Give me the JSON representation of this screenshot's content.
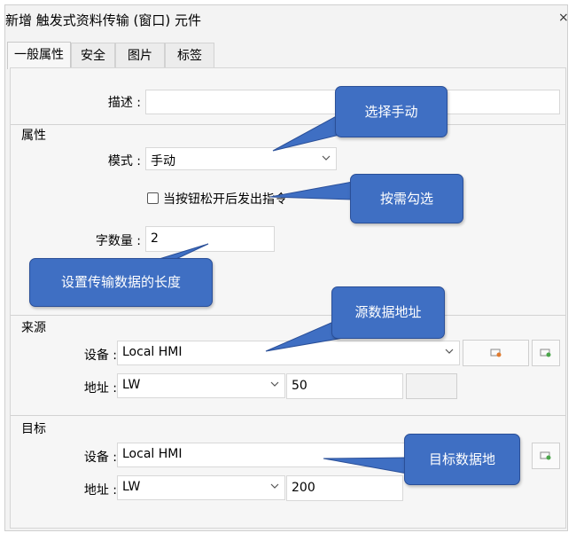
{
  "window": {
    "title": "新增 触发式资料传输 (窗口) 元件",
    "close_glyph": "×"
  },
  "tabs": [
    {
      "label": "一般属性",
      "active": true
    },
    {
      "label": "安全",
      "active": false
    },
    {
      "label": "图片",
      "active": false
    },
    {
      "label": "标签",
      "active": false
    }
  ],
  "form": {
    "description_label": "描述 :",
    "description_value": "",
    "attributes_section": "属性",
    "mode_label": "模式 :",
    "mode_value": "手动",
    "checkbox_label": "当按钮松开后发出指令",
    "checkbox_checked": false,
    "word_count_label": "字数量 :",
    "word_count_value": "2"
  },
  "source": {
    "section": "来源",
    "device_label": "设备 :",
    "device_value": "Local HMI",
    "address_label": "地址 :",
    "address_type": "LW",
    "address_value": "50"
  },
  "target": {
    "section": "目标",
    "device_label": "设备 :",
    "device_value": "Local HMI",
    "address_label": "地址 :",
    "address_type": "LW",
    "address_value": "200"
  },
  "callouts": {
    "select_manual": "选择手动",
    "check_as_needed": "按需勾选",
    "set_length": "设置传输数据的长度",
    "source_address": "源数据地址",
    "target_address": "目标数据地"
  },
  "colors": {
    "callout_fill": "#3f6fc3",
    "callout_border": "#2a4f98"
  },
  "icons": [
    "close-icon",
    "chevron-down-icon",
    "device-settings-icon",
    "device-refresh-icon"
  ]
}
